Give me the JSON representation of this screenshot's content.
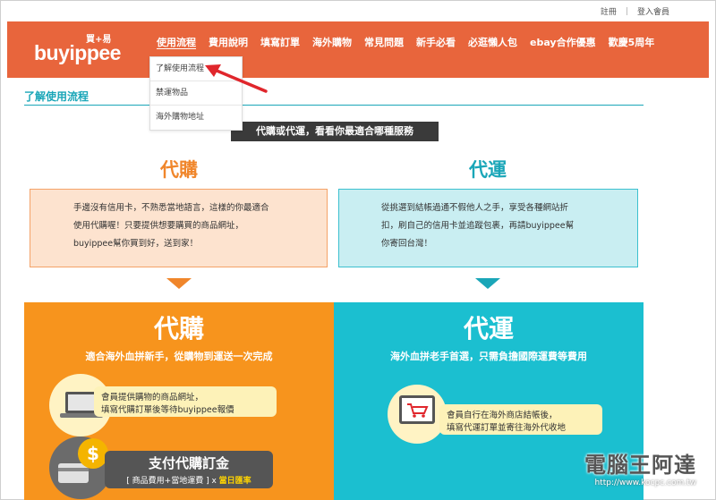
{
  "topbar": {
    "register": "註冊",
    "separator": "|",
    "login": "登入會員"
  },
  "header": {
    "logo_main": "buyippee",
    "logo_sub": "買+易",
    "nav": [
      "使用流程",
      "費用說明",
      "填寫訂單",
      "海外購物",
      "常見問題",
      "新手必看",
      "必逛懶人包",
      "ebay合作優惠",
      "歡慶5周年"
    ]
  },
  "dropdown": {
    "items": [
      "了解使用流程",
      "禁運物品",
      "海外購物地址"
    ]
  },
  "page": {
    "title": "了解使用流程",
    "banner": "代購或代運，看看你最適合哪種服務"
  },
  "left": {
    "heading": "代購",
    "desc_lines": [
      "手邊沒有信用卡，不熟悉當地語言，這樣的你最適合",
      "使用代購喔！只要提供想要購買的商品網址，",
      "buyippee幫你買到好，送到家！"
    ],
    "panel_title": "代購",
    "panel_sub": "適合海外血拼新手，從購物到運送一次完成",
    "step1_lines": [
      "會員提供購物的商品網址，",
      "填寫代購訂單後等待buyippee報價"
    ],
    "pay_title": "支付代購訂金",
    "pay_note_prefix": "[ 商品費用+當地運費 ] x ",
    "pay_note_highlight": "當日匯率",
    "dollar": "$"
  },
  "right": {
    "heading": "代運",
    "desc_lines": [
      "從挑選到結帳過通不假他人之手，享受各種網站折",
      "扣，刷自己的信用卡並追蹤包裹，再請buyippee幫",
      "你寄回台灣！"
    ],
    "panel_title": "代運",
    "panel_sub": "海外血拼老手首選，只需負擔國際運費等費用",
    "step1_lines": [
      "會員自行在海外商店結帳後，",
      "填寫代運訂單並寄往海外代收地"
    ]
  },
  "watermark": {
    "main": "電腦王阿達",
    "url": "http://www.kocpc.com.tw"
  },
  "colors": {
    "header": "#e8653c",
    "orange": "#f7941d",
    "teal": "#1bbfd0",
    "accent_teal": "#1aa6b8",
    "annotation": "#e0262c"
  }
}
